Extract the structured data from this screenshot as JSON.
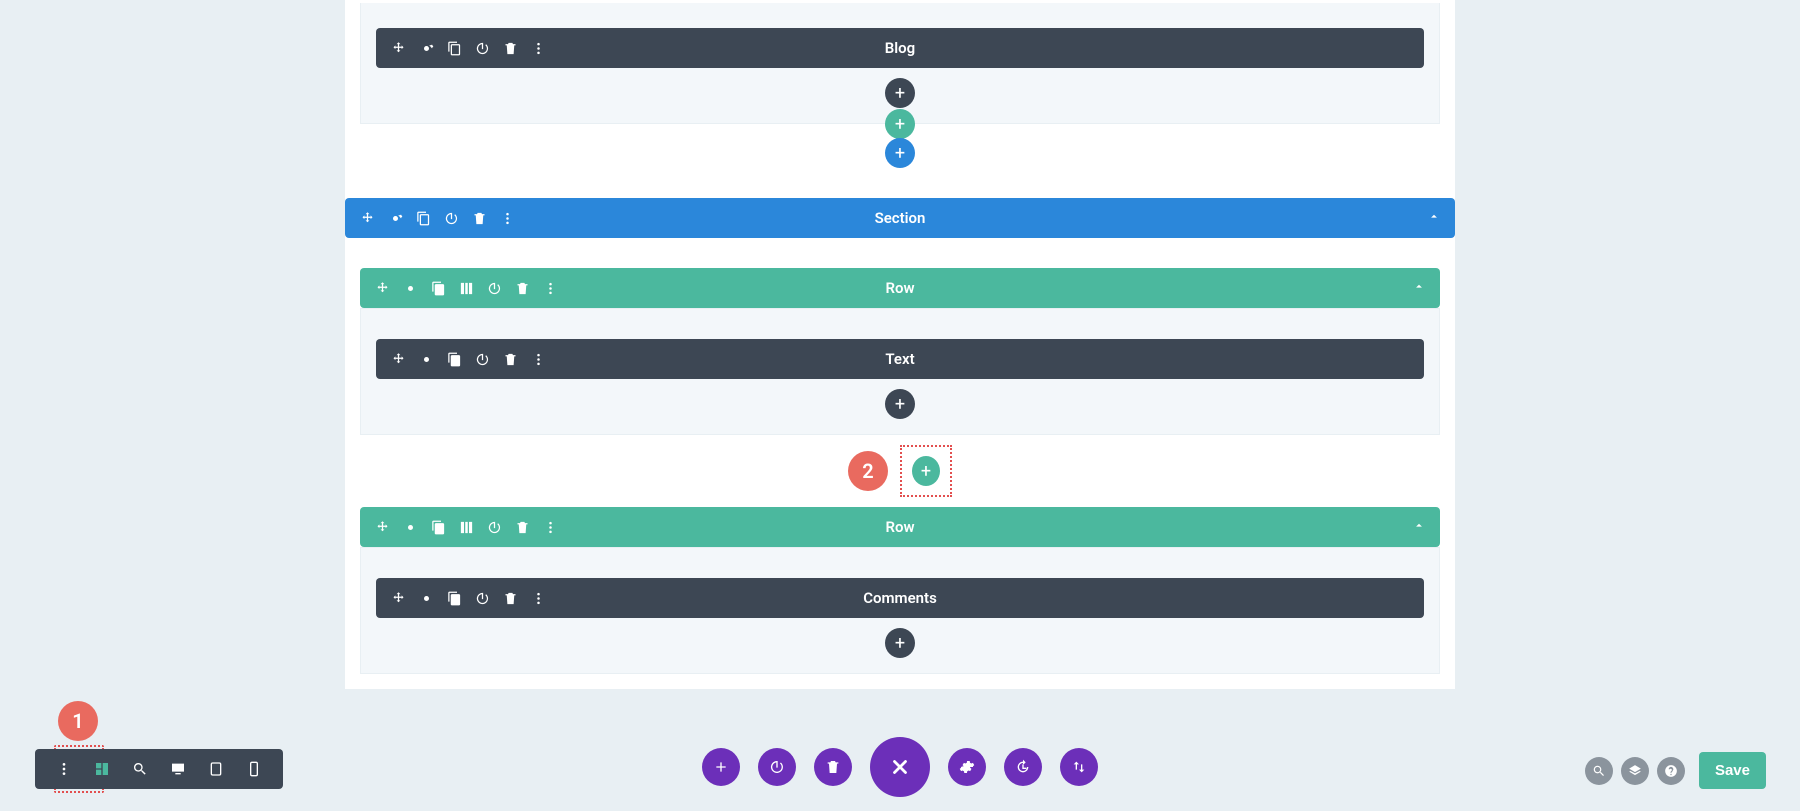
{
  "modules": {
    "blog": "Blog",
    "text": "Text",
    "comments": "Comments"
  },
  "section_label": "Section",
  "row_label": "Row",
  "adds": {
    "plus": "+"
  },
  "annotations": {
    "one": "1",
    "two": "2"
  },
  "bottom_toolbar": {
    "save": "Save"
  },
  "icons": {
    "move": "move-icon",
    "gear": "gear-icon",
    "duplicate": "duplicate-icon",
    "columns": "columns-icon",
    "power": "power-icon",
    "trash": "trash-icon",
    "kebab": "kebab-icon",
    "collapse": "chevron-up-icon",
    "wireframe": "wireframe-icon",
    "zoom": "zoom-icon",
    "desktop": "desktop-icon",
    "tablet": "tablet-icon",
    "phone": "phone-icon",
    "plus": "plus-icon",
    "close": "close-icon",
    "history": "history-icon",
    "swap": "swap-icon",
    "help": "help-icon",
    "layers": "layers-icon"
  }
}
